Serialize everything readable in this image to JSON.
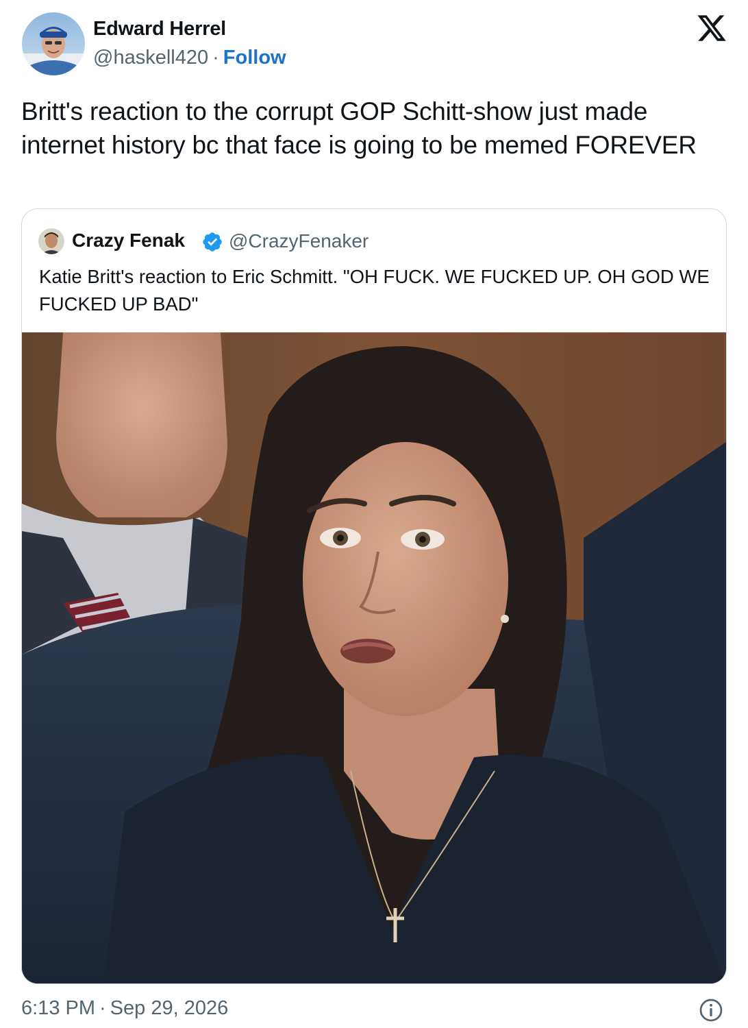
{
  "author": {
    "name": "Edward Herrel",
    "handle": "@haskell420",
    "separator": "·",
    "follow_label": "Follow",
    "avatar_icon": "user-avatar"
  },
  "brand_icon": "x-logo-icon",
  "tweet": {
    "text": "Britt's reaction to the corrupt GOP Schitt-show just made internet history bc that face is going to be memed FOREVER"
  },
  "quote": {
    "name": "Crazy Fenak",
    "handle": "@CrazyFenaker",
    "verified_icon": "verified-badge-icon",
    "text": "Katie Britt's reaction to Eric Schmitt. \"OH FUCK. WE FUCKED UP. OH GOD WE FUCKED UP BAD\"",
    "media": "photo of a woman with dark hair in a navy top seated in a hearing room, a man in a suit and striped tie behind her"
  },
  "footer": {
    "time": "6:13 PM",
    "separator": "·",
    "date": "Sep 29, 2026",
    "info_icon": "info-icon"
  },
  "colors": {
    "text": "#0f1419",
    "secondary": "#536471",
    "link": "#1d73c8",
    "verified": "#1d9bf0",
    "border": "#cfd9de"
  }
}
